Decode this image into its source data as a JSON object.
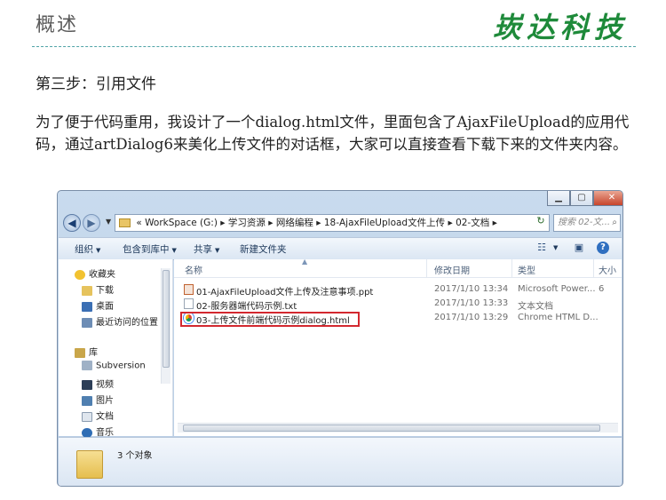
{
  "slide": {
    "title": "概述",
    "brand": "崁达科技",
    "step": "第三步：引用文件",
    "paragraph": "为了便于代码重用，我设计了一个dialog.html文件，里面包含了AjaxFileUpload的应用代码，通过artDialog6来美化上传文件的对话框，大家可以直接查看下载下来的文件夹内容。"
  },
  "window": {
    "controls": {
      "minimize": "▁",
      "maximize": "▢",
      "close": "✕"
    },
    "address": {
      "prefix": "«",
      "segments": [
        "WorkSpace (G:)",
        "学习资源",
        "网络编程",
        "18-AjaxFileUpload文件上传",
        "02-文档"
      ],
      "separator": "▸"
    },
    "search_placeholder": "搜索 02-文...",
    "toolbar": {
      "organize": "组织",
      "include_in_library": "包含到库中",
      "share": "共享",
      "new_folder": "新建文件夹"
    },
    "nav": {
      "favorites": "收藏夹",
      "downloads": "下载",
      "desktop": "桌面",
      "recent": "最近访问的位置",
      "libraries": "库",
      "subversion": "Subversion",
      "videos": "视频",
      "pictures": "图片",
      "documents": "文档",
      "music": "音乐"
    },
    "columns": {
      "name": "名称",
      "modified": "修改日期",
      "type": "类型",
      "size": "大小"
    },
    "files": [
      {
        "name": "01-AjaxFileUpload文件上传及注意事项.ppt",
        "modified": "2017/1/10 13:34",
        "type": "Microsoft Power...",
        "size": "6",
        "icon": "ppt-icon"
      },
      {
        "name": "02-服务器端代码示例.txt",
        "modified": "2017/1/10 13:33",
        "type": "文本文档",
        "size": "",
        "icon": "txt-icon"
      },
      {
        "name": "03-上传文件前端代码示例dialog.html",
        "modified": "2017/1/10 13:29",
        "type": "Chrome HTML D...",
        "size": "",
        "icon": "chrome-icon"
      }
    ],
    "status": {
      "count": "3 个对象"
    }
  },
  "colors": {
    "brand": "#1e8a3a",
    "highlight": "#d3282f",
    "rule": "#4fa3a6"
  }
}
